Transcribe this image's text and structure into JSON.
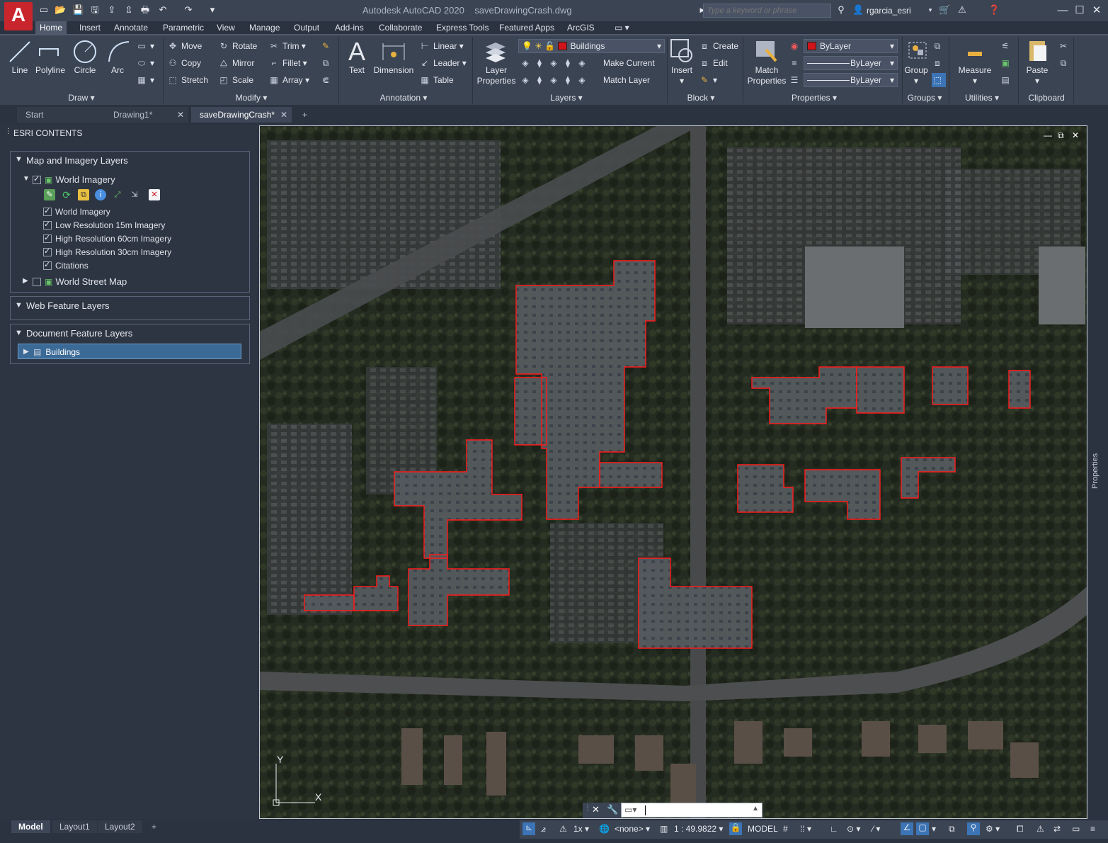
{
  "app": {
    "title": "Autodesk AutoCAD 2020",
    "document": "saveDrawingCrash.dwg",
    "logo_letter": "A"
  },
  "search": {
    "placeholder": "Type a keyword or phrase"
  },
  "user": {
    "name": "rgarcia_esri"
  },
  "ribbon_tabs": [
    "Home",
    "Insert",
    "Annotate",
    "Parametric",
    "View",
    "Manage",
    "Output",
    "Add-ins",
    "Collaborate",
    "Express Tools",
    "Featured Apps",
    "ArcGIS"
  ],
  "ribbon": {
    "draw": {
      "title": "Draw",
      "line": "Line",
      "polyline": "Polyline",
      "circle": "Circle",
      "arc": "Arc"
    },
    "modify": {
      "title": "Modify",
      "move": "Move",
      "rotate": "Rotate",
      "trim": "Trim",
      "copy": "Copy",
      "mirror": "Mirror",
      "fillet": "Fillet",
      "stretch": "Stretch",
      "scale": "Scale",
      "array": "Array"
    },
    "annotation": {
      "title": "Annotation",
      "text": "Text",
      "dimension": "Dimension",
      "linear": "Linear",
      "leader": "Leader",
      "table": "Table"
    },
    "layers": {
      "title": "Layers",
      "layer_properties_1": "Layer",
      "layer_properties_2": "Properties",
      "current_layer": "Buildings",
      "make_current": "Make Current",
      "match_layer": "Match Layer"
    },
    "block": {
      "title": "Block",
      "insert": "Insert",
      "create": "Create",
      "edit": "Edit"
    },
    "properties": {
      "title": "Properties",
      "match_1": "Match",
      "match_2": "Properties",
      "color": "ByLayer",
      "linetype": "ByLayer",
      "lineweight": "ByLayer"
    },
    "groups": {
      "title": "Groups",
      "group": "Group"
    },
    "utilities": {
      "title": "Utilities",
      "measure": "Measure"
    },
    "clipboard": {
      "title": "Clipboard",
      "paste": "Paste"
    }
  },
  "doc_tabs": [
    {
      "label": "Start"
    },
    {
      "label": "Drawing1*"
    },
    {
      "label": "saveDrawingCrash*"
    }
  ],
  "esri": {
    "title": "ESRI CONTENTS",
    "map_imagery_group": "Map and Imagery Layers",
    "world_imagery": "World Imagery",
    "sublayers": [
      "World Imagery",
      "Low Resolution 15m Imagery",
      "High Resolution 60cm Imagery",
      "High Resolution 30cm Imagery",
      "Citations"
    ],
    "world_street_map": "World Street Map",
    "web_feature_group": "Web Feature Layers",
    "document_feature_group": "Document Feature Layers",
    "buildings_layer": "Buildings"
  },
  "side_palette": {
    "label": "Properties"
  },
  "ucs": {
    "x": "X",
    "y": "Y"
  },
  "layout_tabs": [
    "Model",
    "Layout1",
    "Layout2"
  ],
  "status": {
    "annotation_scale": "1x",
    "coordinate_system": "<none>",
    "map_scale": "1 : 49.9822",
    "space": "MODEL"
  },
  "colors": {
    "accent": "#3c74b6",
    "layer_red": "#d0141a",
    "brand_red": "#c8252c"
  },
  "buildings_outline_color": "#ff1a1a"
}
